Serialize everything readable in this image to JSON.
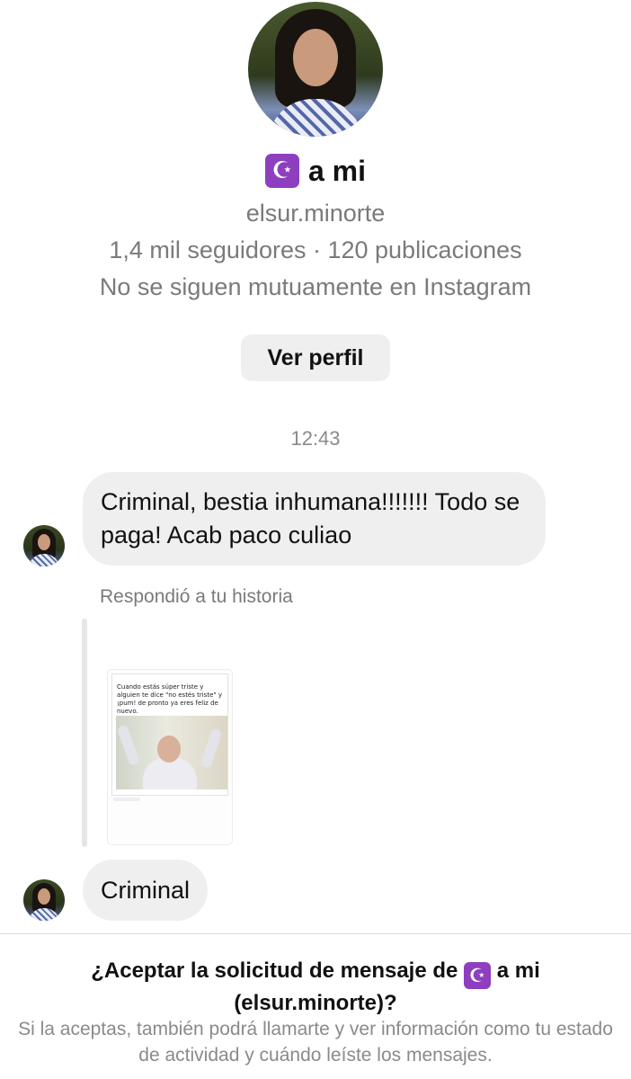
{
  "profile": {
    "emoji": "☪",
    "display_name": "a mi",
    "username": "elsur.minorte",
    "stats": "1,4 mil seguidores · 120 publicaciones",
    "mutual": "No se siguen mutuamente en Instagram",
    "view_profile_label": "Ver perfil",
    "emoji_color": "#8e3fbf"
  },
  "thread": {
    "timestamp": "12:43",
    "messages": [
      {
        "text": "Criminal, bestia inhumana!!!!!!! Todo se paga! Acab paco culiao"
      },
      {
        "text": "Criminal"
      }
    ],
    "replied_label": "Respondió a tu historia",
    "story": {
      "caption": "Cuando estás súper triste y alguien te dice \"no estés triste\" y ¡pum! de pronto ya eres feliz de nuevo."
    }
  },
  "request": {
    "title_prefix": "¿Aceptar la solicitud de mensaje de",
    "title_emoji": "☪",
    "title_name": "a mi",
    "title_username": "(elsur.minorte)?",
    "description": "Si la aceptas, también podrá llamarte y ver información como tu estado de actividad y cuándo leíste los mensajes."
  }
}
